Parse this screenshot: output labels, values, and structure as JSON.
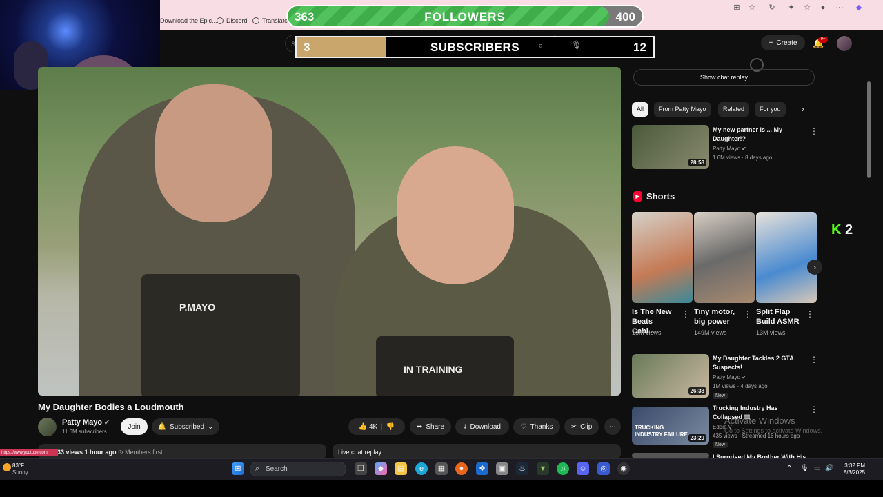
{
  "browser": {
    "bookmarks": [
      "Download the Epic...",
      "Discord",
      "Translate"
    ]
  },
  "followers_goal": {
    "current": "363",
    "label": "FOLLOWERS",
    "goal": "400",
    "progress": 0.9075
  },
  "subscribers_goal": {
    "current": "3",
    "label": "SUBSCRIBERS",
    "goal": "12",
    "progress": 0.25
  },
  "header": {
    "search_placeholder": "Search",
    "create_label": "Create",
    "notif_count": "9+"
  },
  "video": {
    "title": "My Daughter Bodies a Loudmouth",
    "patch_left": "P.MAYO",
    "patch_right": "IN TRAINING",
    "channel": "Patty Mayo",
    "subscribers": "11.6M subscribers",
    "join_label": "Join",
    "subscribed_label": "Subscribed",
    "likes": "4K",
    "share_label": "Share",
    "download_label": "Download",
    "thanks_label": "Thanks",
    "clip_label": "Clip",
    "views_line": "33 views  1 hour ago",
    "members_first": "Members first",
    "live_chat_replay": "Live chat replay"
  },
  "sidebar": {
    "show_chat_replay": "Show chat replay",
    "chips": [
      "All",
      "From Patty Mayo",
      "Related",
      "For you"
    ],
    "videos": [
      {
        "title": "My new partner is ... My Daughter!?",
        "channel": "Patty Mayo",
        "meta": "1.6M views · 8 days ago",
        "duration": "28:58",
        "new": ""
      },
      {
        "title": "My Daughter Tackles 2 GTA Suspects!",
        "channel": "Patty Mayo",
        "meta": "1M views · 4 days ago",
        "duration": "26:38",
        "new": "New"
      },
      {
        "title": "Trucking Industry Has Collapsed !!!",
        "channel": "Eddie V",
        "meta": "435 views · Streamed 16 hours ago",
        "duration": "23:29",
        "new": "New",
        "thumb_text": "TRUCKING INDUSTRY FAILURE"
      },
      {
        "title": "I Surprised My Brother With His",
        "channel": "",
        "meta": "",
        "duration": "",
        "new": ""
      }
    ],
    "shorts_heading": "Shorts",
    "shorts": [
      {
        "title": "Is The New Beats Cabl...",
        "views": "13M views"
      },
      {
        "title": "Tiny motor, big power",
        "views": "149M views"
      },
      {
        "title": "Split Flap Build ASMR",
        "views": "13M views"
      }
    ]
  },
  "overlay": {
    "kick_count": "2",
    "windows_line1": "Activate Windows",
    "windows_line2": "Go to Settings to activate Windows.",
    "url_tag": "https://www.youtube.com"
  },
  "taskbar": {
    "weather_temp": "83°F",
    "weather_desc": "Sunny",
    "search_label": "Search",
    "time": "3:32 PM",
    "date": "8/3/2025"
  },
  "colors": {
    "youtube_red": "#ff0033",
    "followers_green": "#3fae4a",
    "subs_tan": "#c9a66b",
    "kick_green": "#53fc18",
    "chrome_pink": "#f9dde4"
  }
}
